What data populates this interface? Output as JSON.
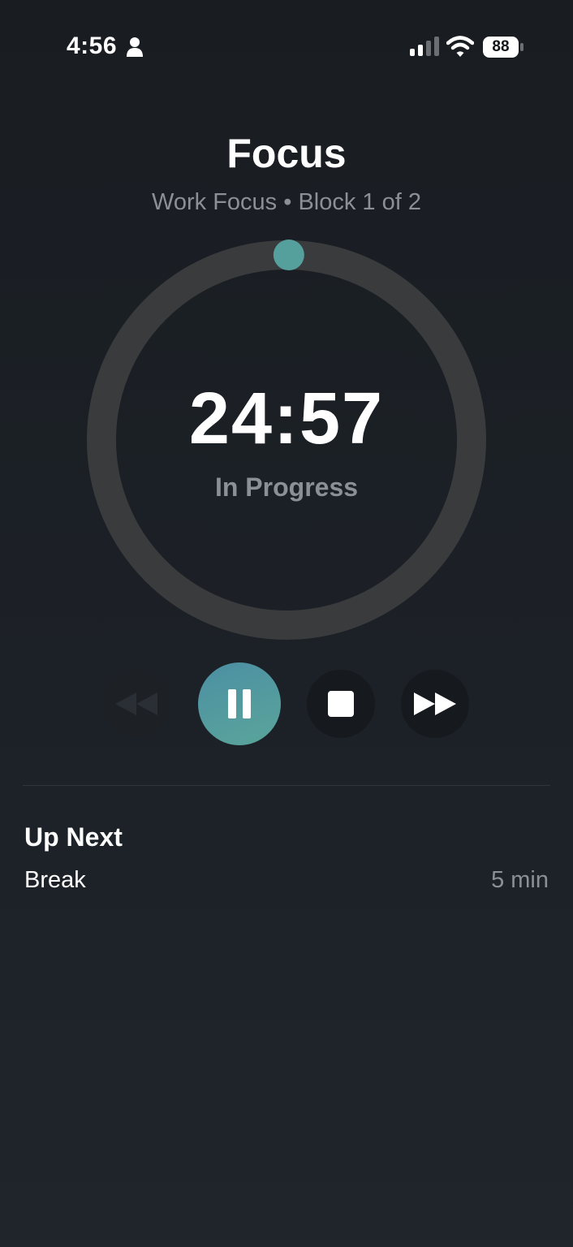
{
  "status_bar": {
    "time": "4:56",
    "battery": "88"
  },
  "header": {
    "title": "Focus",
    "subtitle": "Work Focus • Block 1 of 2"
  },
  "timer": {
    "time_remaining": "24:57",
    "status": "In Progress",
    "progress_fraction": 0.002
  },
  "controls": {
    "rewind_icon": "rewind-icon",
    "pause_icon": "pause-icon",
    "stop_icon": "stop-icon",
    "forward_icon": "fast-forward-icon"
  },
  "up_next": {
    "heading": "Up Next",
    "items": [
      {
        "name": "Break",
        "duration": "5 min"
      }
    ]
  },
  "colors": {
    "accent": "#55a09c",
    "ring_track": "#3a3b3d",
    "background": "#1b2025",
    "secondary_text": "#8b9096"
  }
}
